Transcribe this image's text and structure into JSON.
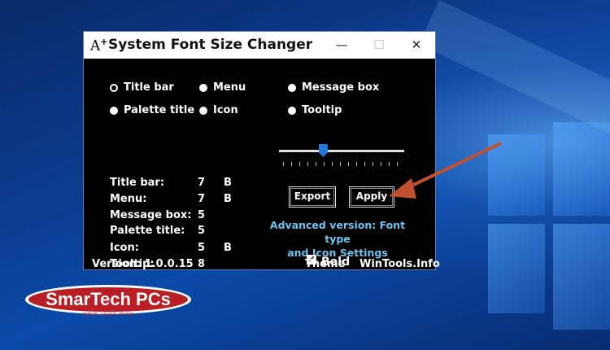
{
  "window": {
    "title": "System Font Size Changer",
    "minimize": "—",
    "maximize": "☐",
    "close": "✕"
  },
  "radios": [
    {
      "label": "Title bar",
      "selected": true
    },
    {
      "label": "Menu",
      "selected": false
    },
    {
      "label": "Message box",
      "selected": false
    },
    {
      "label": "Palette title",
      "selected": false
    },
    {
      "label": "Icon",
      "selected": false
    },
    {
      "label": "Tooltip",
      "selected": false
    }
  ],
  "sizes": [
    {
      "label": "Title bar:",
      "value": "7",
      "bold": "B"
    },
    {
      "label": "Menu:",
      "value": "7",
      "bold": "B"
    },
    {
      "label": "Message box:",
      "value": "5",
      "bold": ""
    },
    {
      "label": "Palette title:",
      "value": "5",
      "bold": ""
    },
    {
      "label": "Icon:",
      "value": "5",
      "bold": "B"
    },
    {
      "label": "Tooltip:",
      "value": "8",
      "bold": ""
    }
  ],
  "slider": {
    "level": 0.35
  },
  "buttons": {
    "export": "Export",
    "apply": "Apply"
  },
  "advanced": {
    "line1": "Advanced version: Font type",
    "line2": "and Icon Settings"
  },
  "footer": {
    "version": "Version: 1.0.0.15",
    "bold_label": "Bold",
    "bold_checked": true,
    "theme": "Theme",
    "site": "WinTools.Info"
  },
  "watermark": {
    "text": "SmarTech PCs",
    "subtitle": "שירותי מחשוב חכמים"
  },
  "colors": {
    "accent": "#1e7ae0",
    "link": "#6cc3f0",
    "arrow": "#c0502e",
    "logo_red": "#b81e24"
  },
  "icons": {
    "app": "font-size-icon",
    "check": "checkmark-icon"
  }
}
